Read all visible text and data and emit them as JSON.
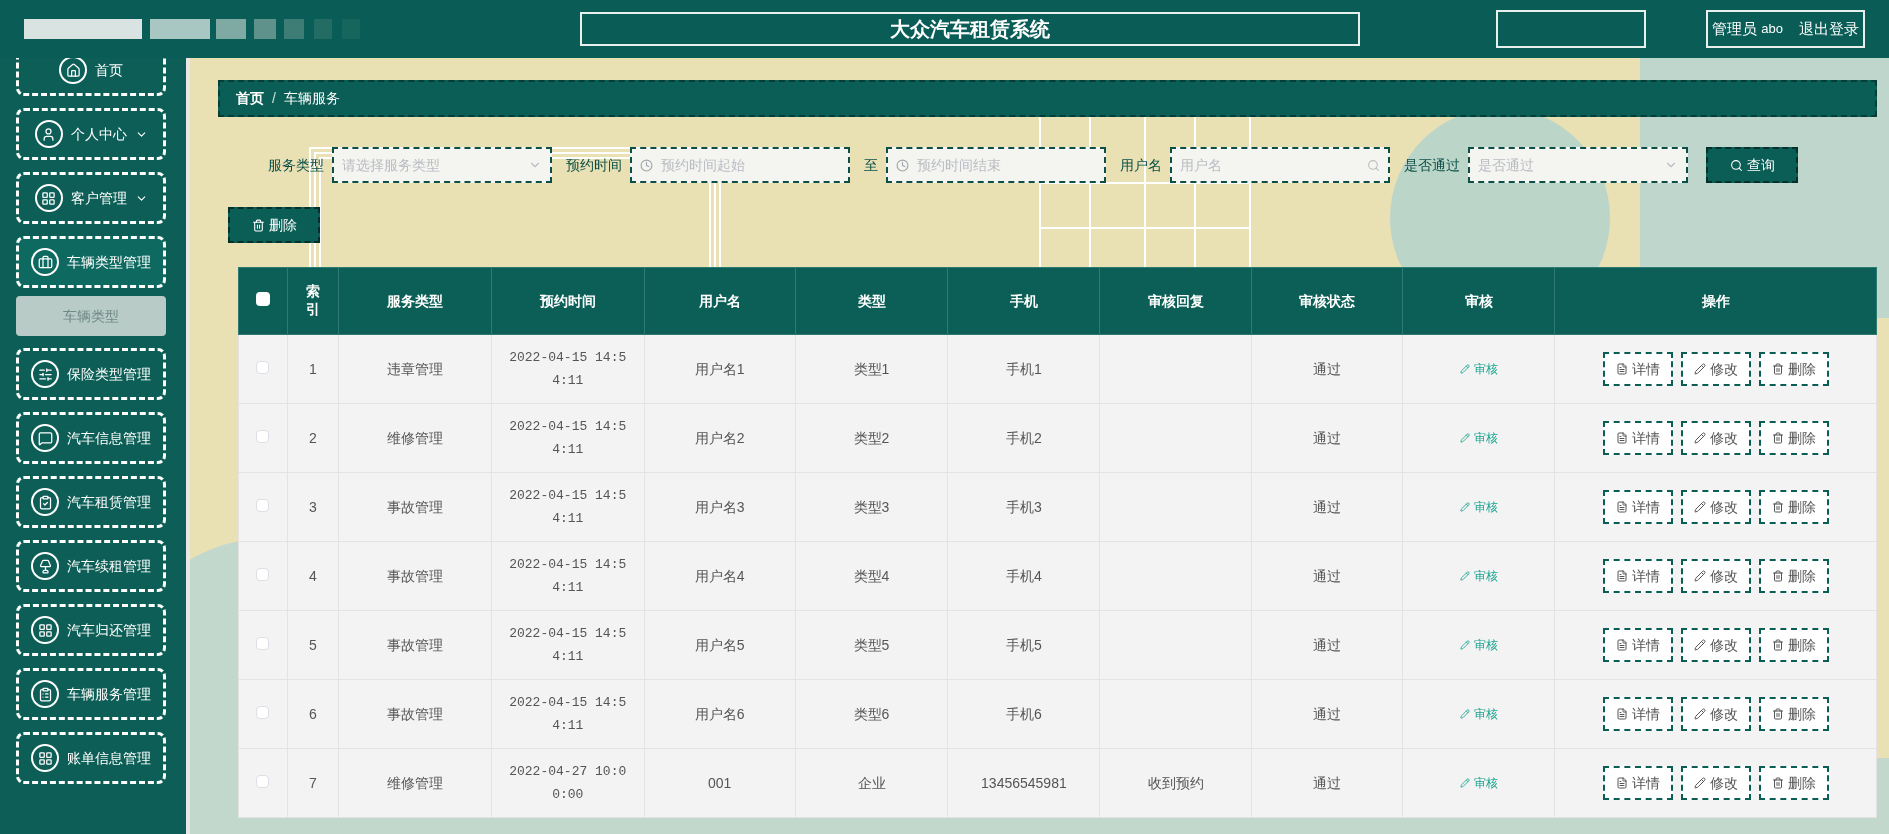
{
  "header": {
    "title": "大众汽车租赁系统",
    "user_role": "管理员",
    "user_name": "abo",
    "logout": "退出登录"
  },
  "sidebar": {
    "items": [
      {
        "label": "首页",
        "submenu_arrow": false,
        "expanded": false
      },
      {
        "label": "个人中心",
        "submenu_arrow": true,
        "expanded": false
      },
      {
        "label": "客户管理",
        "submenu_arrow": true,
        "expanded": false
      },
      {
        "label": "车辆类型管理",
        "submenu_arrow": false,
        "expanded": true,
        "children": [
          {
            "label": "车辆类型",
            "selected": true
          }
        ]
      },
      {
        "label": "保险类型管理",
        "submenu_arrow": false,
        "expanded": false
      },
      {
        "label": "汽车信息管理",
        "submenu_arrow": false,
        "expanded": false
      },
      {
        "label": "汽车租赁管理",
        "submenu_arrow": false,
        "expanded": false
      },
      {
        "label": "汽车续租管理",
        "submenu_arrow": false,
        "expanded": false
      },
      {
        "label": "汽车归还管理",
        "submenu_arrow": false,
        "expanded": false
      },
      {
        "label": "车辆服务管理",
        "submenu_arrow": false,
        "expanded": false
      },
      {
        "label": "账单信息管理",
        "submenu_arrow": false,
        "expanded": false
      }
    ]
  },
  "breadcrumb": [
    "首页",
    "车辆服务"
  ],
  "breadcrumb_separator": "/",
  "filters": [
    {
      "kind": "select",
      "label": "服务类型",
      "placeholder": "请选择服务类型"
    },
    {
      "kind": "date",
      "label": "预约时间",
      "placeholder": "预约时间起始"
    },
    {
      "kind": "date",
      "label": "至",
      "placeholder": "预约时间结束"
    },
    {
      "kind": "search",
      "label": "用户名",
      "placeholder": "用户名"
    },
    {
      "kind": "select",
      "label": "是否通过",
      "placeholder": "是否通过"
    }
  ],
  "query_button": "查询",
  "delete_button": "删除",
  "table": {
    "columns": [
      "索引",
      "服务类型",
      "预约时间",
      "用户名",
      "类型",
      "手机",
      "审核回复",
      "审核状态",
      "审核",
      "操作"
    ],
    "header_checked": false,
    "rows": [
      {
        "checked": false,
        "index": "1",
        "service": "违章管理",
        "time": "2022-04-15 14:54:11",
        "user": "用户名1",
        "type": "类型1",
        "phone": "手机1",
        "status": "通过",
        "review": "审核",
        "actions": [
          "详情",
          "修改",
          "删除"
        ]
      },
      {
        "checked": false,
        "index": "2",
        "service": "维修管理",
        "time": "2022-04-15 14:54:11",
        "user": "用户名2",
        "type": "类型2",
        "phone": "手机2",
        "status": "通过",
        "review": "审核",
        "actions": [
          "详情",
          "修改",
          "删除"
        ]
      },
      {
        "checked": false,
        "index": "3",
        "service": "事故管理",
        "time": "2022-04-15 14:54:11",
        "user": "用户名3",
        "type": "类型3",
        "phone": "手机3",
        "status": "通过",
        "review": "审核",
        "actions": [
          "详情",
          "修改",
          "删除"
        ]
      },
      {
        "checked": false,
        "index": "4",
        "service": "事故管理",
        "time": "2022-04-15 14:54:11",
        "user": "用户名4",
        "type": "类型4",
        "phone": "手机4",
        "status": "通过",
        "review": "审核",
        "actions": [
          "详情",
          "修改",
          "删除"
        ]
      },
      {
        "checked": false,
        "index": "5",
        "service": "事故管理",
        "time": "2022-04-15 14:54:11",
        "user": "用户名5",
        "type": "类型5",
        "phone": "手机5",
        "status": "通过",
        "review": "审核",
        "actions": [
          "详情",
          "修改",
          "删除"
        ]
      },
      {
        "checked": false,
        "index": "6",
        "service": "事故管理",
        "time": "2022-04-15 14:54:11",
        "user": "用户名6",
        "type": "类型6",
        "phone": "手机6",
        "status": "通过",
        "review": "审核",
        "actions": [
          "详情",
          "修改",
          "删除"
        ]
      },
      {
        "checked": false,
        "index": "7",
        "service": "维修管理",
        "time": "2022-04-27 10:00:00",
        "user": "001",
        "type": "企业",
        "phone": "13456545981",
        "reply": "收到预约",
        "status": "通过",
        "review": "审核",
        "actions": [
          "详情",
          "修改",
          "删除"
        ]
      }
    ]
  }
}
